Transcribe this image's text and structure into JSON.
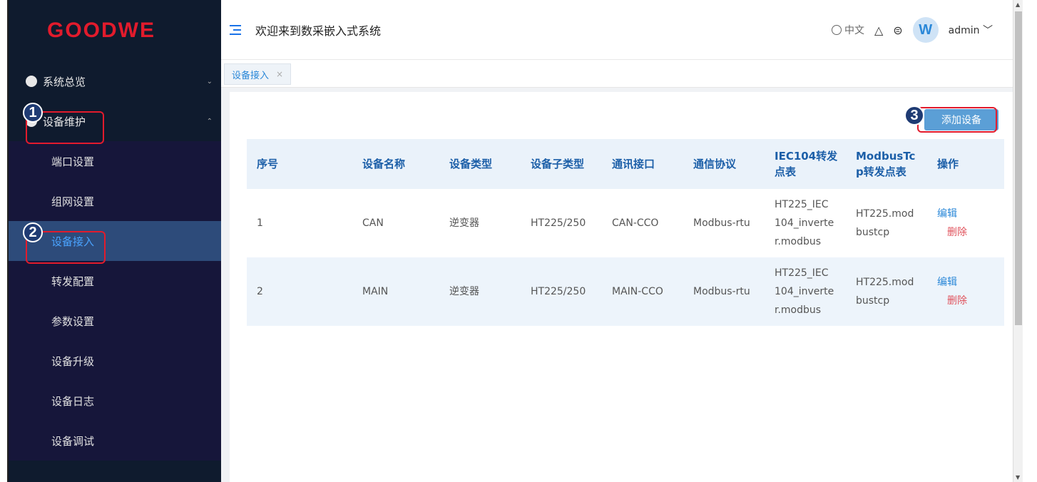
{
  "brand": {
    "logo": "GOODWE",
    "color": "#e21b2c"
  },
  "header": {
    "welcome": "欢迎来到数采嵌入式系统",
    "language": "中文",
    "user": "admin",
    "avatar_letter": "W",
    "icons": [
      "menu-toggle-icon",
      "globe-icon",
      "warning-icon",
      "message-icon",
      "chevron-down-icon"
    ]
  },
  "sidebar": {
    "overview": "系统总览",
    "maintenance": "设备维护",
    "sub_items": [
      {
        "label": "端口设置"
      },
      {
        "label": "组网设置"
      },
      {
        "label": "设备接入",
        "active": true
      },
      {
        "label": "转发配置"
      },
      {
        "label": "参数设置"
      },
      {
        "label": "设备升级"
      },
      {
        "label": "设备日志"
      },
      {
        "label": "设备调试"
      }
    ]
  },
  "tabs": [
    {
      "label": "设备接入",
      "close": "×"
    }
  ],
  "main": {
    "add_button": "添加设备",
    "columns": [
      "序号",
      "设备名称",
      "设备类型",
      "设备子类型",
      "通讯接口",
      "通信协议",
      "IEC104转发\n点表",
      "ModbusTc\np转发点表",
      "操作"
    ],
    "rows": [
      {
        "no": "1",
        "name": "CAN",
        "type": "逆变器",
        "subtype": "HT225/250",
        "interface": "CAN-CCO",
        "protocol": "Modbus-rtu",
        "iec104": "HT225_IEC\n104_inverte\nr.modbus",
        "modbus": "HT225.mod\nbustcp",
        "edit": "编辑",
        "delete": "删除"
      },
      {
        "no": "2",
        "name": "MAIN",
        "type": "逆变器",
        "subtype": "HT225/250",
        "interface": "MAIN-CCO",
        "protocol": "Modbus-rtu",
        "iec104": "HT225_IEC\n104_inverte\nr.modbus",
        "modbus": "HT225.mod\nbustcp",
        "edit": "编辑",
        "delete": "删除"
      }
    ]
  },
  "callouts": [
    "1",
    "2",
    "3"
  ]
}
